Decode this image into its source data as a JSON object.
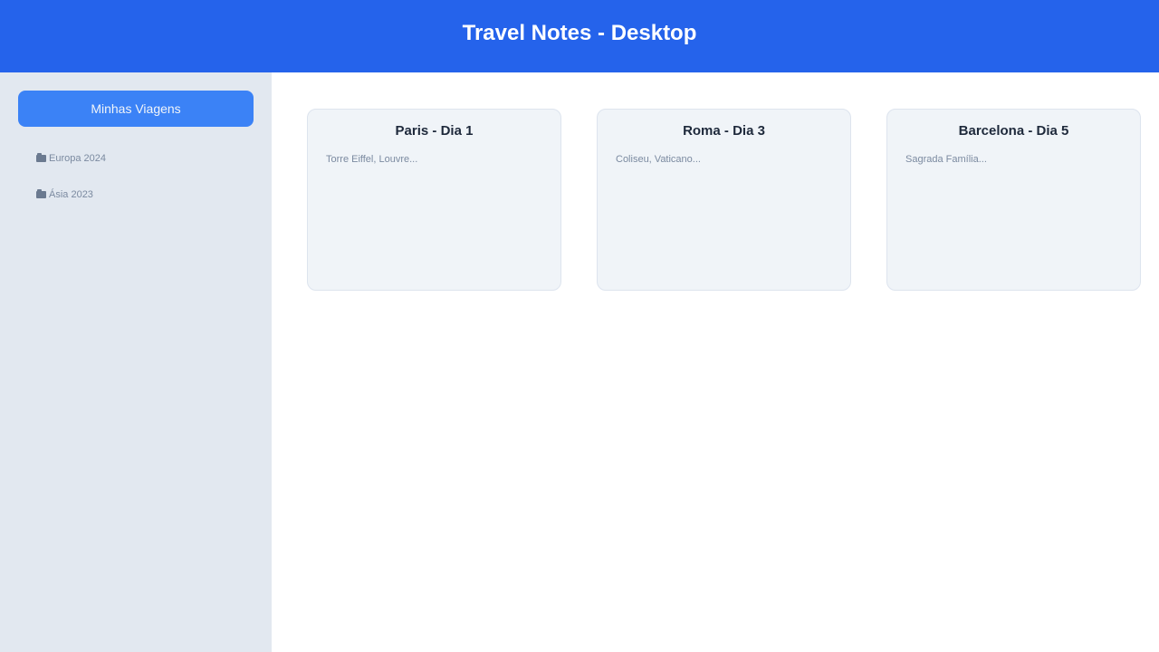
{
  "header": {
    "title": "Travel Notes - Desktop"
  },
  "sidebar": {
    "button_label": "Minhas Viagens",
    "items": [
      {
        "icon": "folder-icon",
        "label": "Europa 2024"
      },
      {
        "icon": "folder-icon",
        "label": "Ásia 2023"
      }
    ]
  },
  "cards": [
    {
      "title": "Paris - Dia 1",
      "description": "Torre Eiffel, Louvre..."
    },
    {
      "title": "Roma - Dia 3",
      "description": "Coliseu, Vaticano..."
    },
    {
      "title": "Barcelona - Dia 5",
      "description": "Sagrada Família..."
    }
  ],
  "colors": {
    "header_bg": "#2563eb",
    "sidebar_bg": "#e2e8f0",
    "button_bg": "#3b82f6",
    "card_bg": "#f0f4f8"
  }
}
